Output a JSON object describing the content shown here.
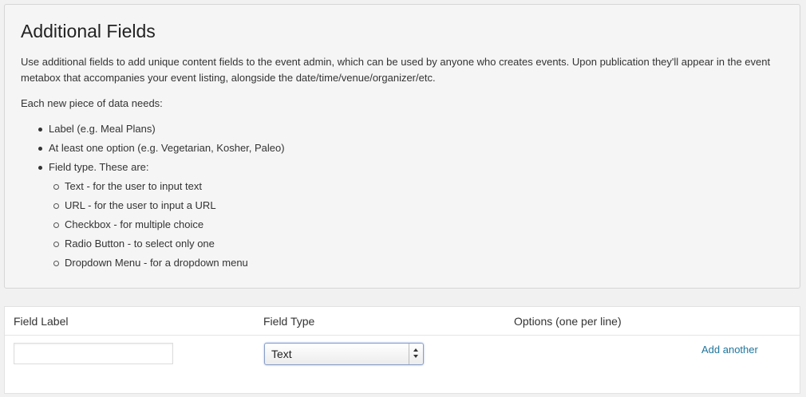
{
  "help": {
    "title": "Additional Fields",
    "intro": "Use additional fields to add unique content fields to the event admin, which can be used by anyone who creates events. Upon publication they'll appear in the event metabox that accompanies your event listing, alongside the date/time/venue/organizer/etc.",
    "needs": "Each new piece of data needs:",
    "requirements": [
      "Label (e.g. Meal Plans)",
      "At least one option (e.g. Vegetarian, Kosher, Paleo)",
      "Field type. These are:"
    ],
    "field_types": [
      "Text - for the user to input text",
      "URL - for the user to input a URL",
      "Checkbox - for multiple choice",
      "Radio Button - to select only one",
      "Dropdown Menu - for a dropdown menu"
    ]
  },
  "table": {
    "col_label": "Field Label",
    "col_type": "Field Type",
    "col_options": "Options (one per line)",
    "label_value": "",
    "type_selected": "Text",
    "add_link": "Add another"
  }
}
